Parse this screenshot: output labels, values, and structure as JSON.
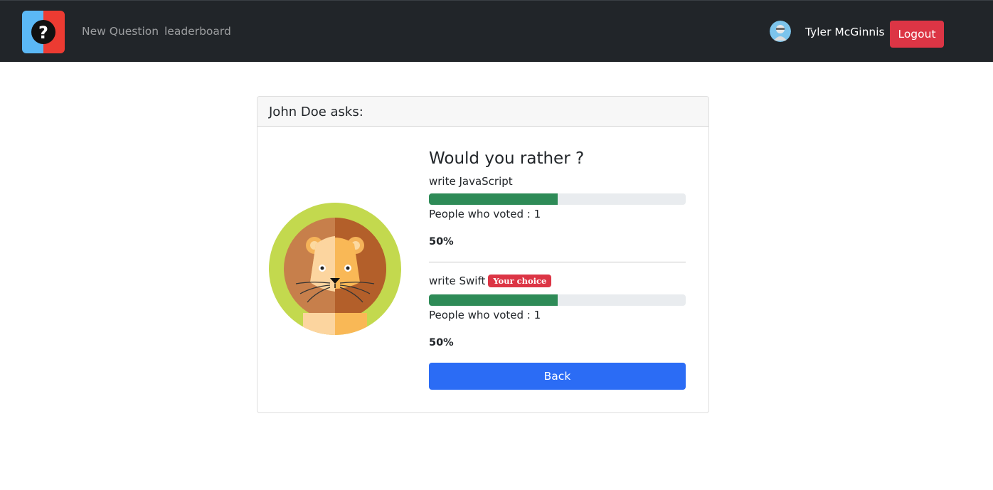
{
  "nav": {
    "logo_icon": "question-mark-logo-icon",
    "links": [
      {
        "label": "New Question"
      },
      {
        "label": "leaderboard"
      }
    ],
    "user": {
      "name": "Tyler McGinnis",
      "avatar_icon": "user-avatar-icon"
    },
    "logout_label": "Logout"
  },
  "question": {
    "author_line": "John Doe asks:",
    "author_avatar_icon": "lion-avatar-icon",
    "title": "Would you rather ?",
    "options": [
      {
        "text": "write JavaScript",
        "voters_text": "People who voted : 1",
        "percent_text": "50%",
        "percent_value": 50,
        "is_choice": false
      },
      {
        "text": "write Swift",
        "voters_text": "People who voted : 1",
        "percent_text": "50%",
        "percent_value": 50,
        "is_choice": true,
        "badge_label": "Your choice"
      }
    ],
    "back_label": "Back"
  },
  "colors": {
    "navbar_bg": "#212529",
    "danger": "#dc3545",
    "primary": "#2b6cf5",
    "progress_fill": "#2e8b57",
    "progress_track": "#e9ecef"
  }
}
